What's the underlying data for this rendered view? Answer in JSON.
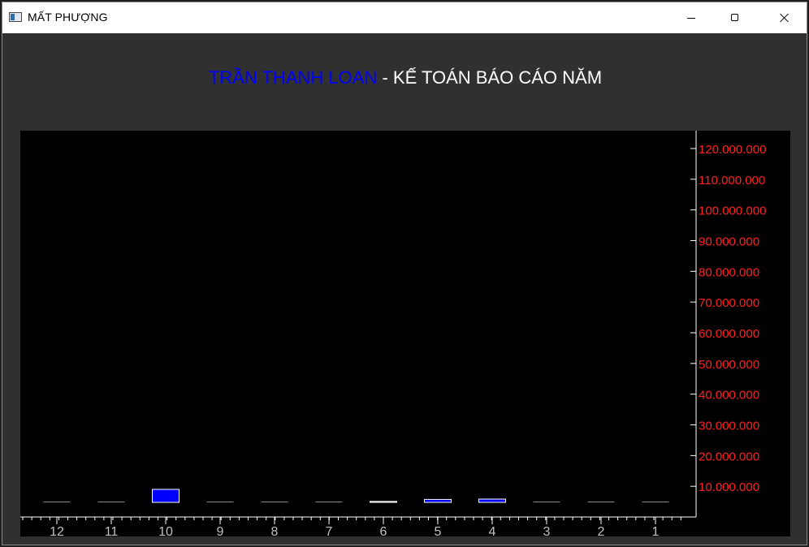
{
  "window": {
    "title": "MẤT PHƯỢNG"
  },
  "header": {
    "name": "TRẦN THANH LOAN",
    "separator": " - ",
    "rest": "KẾ TOÁN BÁO CÁO NĂM"
  },
  "colors": {
    "name": "#0000ff",
    "tick_labels_y": "#ff2020",
    "bar_fill": "#0000ff",
    "bar_stroke": "#ffffff",
    "axis": "#ffffff",
    "x_labels": "#c0c0c0",
    "plot_bg": "#000000"
  },
  "chart_data": {
    "type": "bar",
    "categories": [
      "12",
      "11",
      "10",
      "9",
      "8",
      "7",
      "6",
      "5",
      "4",
      "3",
      "2",
      "1"
    ],
    "values": [
      0,
      0,
      4000000,
      0,
      0,
      0,
      300000,
      900000,
      1000000,
      0,
      0,
      0
    ],
    "ylim": [
      0,
      120000000
    ],
    "y_ticks": [
      "10.000.000",
      "20.000.000",
      "30.000.000",
      "40.000.000",
      "50.000.000",
      "60.000.000",
      "70.000.000",
      "80.000.000",
      "90.000.000",
      "100.000.000",
      "110.000.000",
      "120.000.000"
    ],
    "y_axis_side": "right",
    "grid": false
  }
}
